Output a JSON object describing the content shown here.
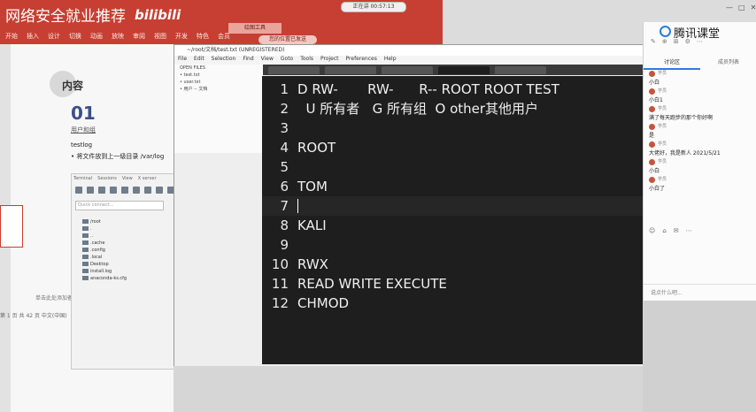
{
  "topbar": {
    "title": "网络安全就业推荐",
    "logo": "bilibili",
    "menu": [
      "开始",
      "插入",
      "设计",
      "切换",
      "动画",
      "放映",
      "审阅",
      "视图",
      "开发",
      "特色",
      "会员"
    ],
    "tool_tab": "绘图工具",
    "status_pill": "您的位置已发送",
    "screen_pill": "正在讲 00:57:13"
  },
  "slide": {
    "heading": "内容",
    "number": "01",
    "subtitle": "用户和组",
    "note1": "testlog",
    "note2": "• 将文件放到上一级目录 /var/log",
    "footer": "单击此处添加备注",
    "status": "第 1 页  共 42 页    中文(中国)"
  },
  "explorer": {
    "menu": [
      "Terminal",
      "Sessions",
      "View",
      "X server"
    ],
    "search_placeholder": "Quick connect...",
    "tree": [
      "/root",
      ".",
      "..",
      ".cache",
      ".config",
      ".local",
      "Desktop",
      "install.log",
      "anaconda-ks.cfg"
    ]
  },
  "editor": {
    "title": "~/root/文档/test.txt (UNREGISTERED)",
    "menu": [
      "File",
      "Edit",
      "Selection",
      "Find",
      "View",
      "Goto",
      "Tools",
      "Project",
      "Preferences",
      "Help"
    ],
    "side_items": [
      "OPEN FILES",
      "• test.txt",
      "• user.txt",
      "• 用户 -- 文档"
    ],
    "active_line": 7,
    "lines": [
      {
        "n": "1",
        "text": "D RW-       RW-      R-- ROOT ROOT TEST"
      },
      {
        "n": "2",
        "text": "  U 所有者   G 所有组  O other其他用户"
      },
      {
        "n": "3",
        "text": ""
      },
      {
        "n": "4",
        "text": "ROOT"
      },
      {
        "n": "5",
        "text": ""
      },
      {
        "n": "6",
        "text": "TOM"
      },
      {
        "n": "7",
        "text": ""
      },
      {
        "n": "8",
        "text": "KALI"
      },
      {
        "n": "9",
        "text": ""
      },
      {
        "n": "10",
        "text": "RWX"
      },
      {
        "n": "11",
        "text": "READ WRITE EXECUTE"
      },
      {
        "n": "12",
        "text": "CHMOD"
      }
    ]
  },
  "chat": {
    "logo": "腾讯课堂",
    "toolbar": [
      "✎",
      "⊕",
      "⊞",
      "⚙",
      "⋯"
    ],
    "tabs": [
      "讨论区",
      "成员列表"
    ],
    "messages": [
      {
        "user": "学员",
        "text": "小白"
      },
      {
        "user": "学员",
        "text": "小白1"
      },
      {
        "user": "学员",
        "text": "满了每天跑步的那个你好啊"
      },
      {
        "user": "学员",
        "text": "是"
      },
      {
        "user": "学员",
        "text": "大佬好，我是新人 2021/5/21"
      },
      {
        "user": "学员",
        "text": "小白"
      },
      {
        "user": "学员",
        "text": "小白了"
      }
    ],
    "emoji_row": [
      "☺",
      "⌂",
      "✉",
      "⋯"
    ],
    "input_hint": "说点什么吧..."
  },
  "window_controls": [
    "—",
    "□",
    "✕"
  ],
  "colors": {
    "brand_red": "#c63f32",
    "editor_bg": "#1e1e1e",
    "accent_blue": "#2a7de1"
  }
}
